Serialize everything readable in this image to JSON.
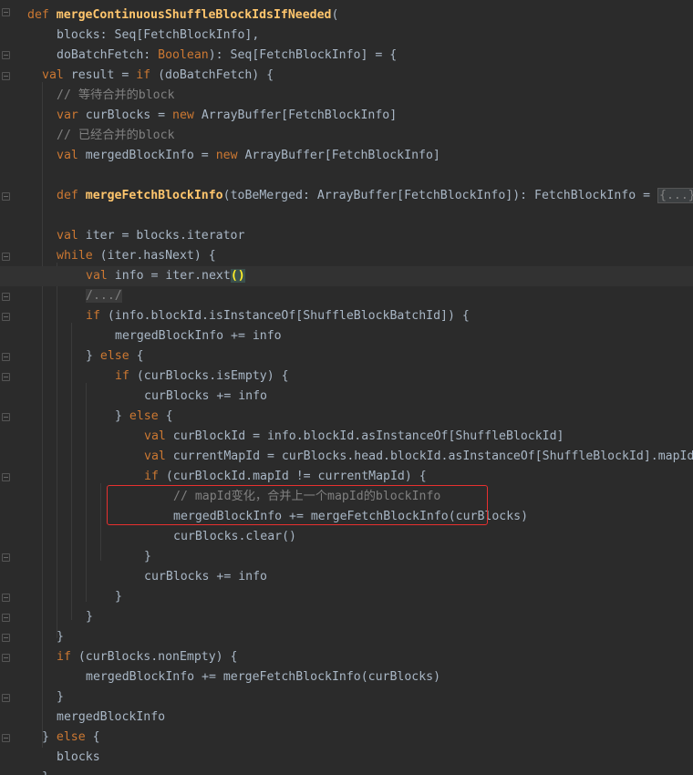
{
  "editor": {
    "language": "scala",
    "highlight_color": "#e8302f",
    "lines": [
      {
        "indent": 0,
        "tokens": [
          [
            "kw",
            "def "
          ],
          [
            "fn",
            "mergeContinuousShuffleBlockIdsIfNeeded"
          ],
          [
            "pu",
            "("
          ]
        ]
      },
      {
        "indent": 1,
        "tokens": [
          [
            "pu",
            "blocks: Seq[FetchBlockInfo],"
          ]
        ]
      },
      {
        "indent": 1,
        "tokens": [
          [
            "pu",
            "doBatchFetch: "
          ],
          [
            "kw",
            "Boolean"
          ],
          [
            "pu",
            "): Seq[FetchBlockInfo] = {"
          ]
        ]
      },
      {
        "indent": 0.5,
        "tokens": [
          [
            "kw",
            "val "
          ],
          [
            "pu",
            "result = "
          ],
          [
            "kw",
            "if "
          ],
          [
            "pu",
            "(doBatchFetch) {"
          ]
        ]
      },
      {
        "indent": 1,
        "tokens": [
          [
            "cm",
            "// 等待合并的block"
          ]
        ]
      },
      {
        "indent": 1,
        "tokens": [
          [
            "kw",
            "var "
          ],
          [
            "pu",
            "curBlocks = "
          ],
          [
            "kw",
            "new "
          ],
          [
            "pu",
            "ArrayBuffer[FetchBlockInfo]"
          ]
        ]
      },
      {
        "indent": 1,
        "tokens": [
          [
            "cm",
            "// 已经合并的block"
          ]
        ]
      },
      {
        "indent": 1,
        "tokens": [
          [
            "kw",
            "val "
          ],
          [
            "pu",
            "mergedBlockInfo = "
          ],
          [
            "kw",
            "new "
          ],
          [
            "pu",
            "ArrayBuffer[FetchBlockInfo]"
          ]
        ]
      },
      {
        "indent": 1,
        "tokens": []
      },
      {
        "indent": 1,
        "tokens": [
          [
            "kw",
            "def "
          ],
          [
            "fn",
            "mergeFetchBlockInfo"
          ],
          [
            "pu",
            "(toBeMerged: ArrayBuffer[FetchBlockInfo]): FetchBlockInfo = "
          ],
          [
            "fold",
            "{...}"
          ]
        ]
      },
      {
        "indent": 1,
        "tokens": []
      },
      {
        "indent": 1,
        "tokens": [
          [
            "kw",
            "val "
          ],
          [
            "pu",
            "iter = blocks.iterator"
          ]
        ]
      },
      {
        "indent": 1,
        "tokens": [
          [
            "kw",
            "while "
          ],
          [
            "pu",
            "(iter.hasNext) {"
          ]
        ]
      },
      {
        "indent": 2,
        "caret": true,
        "tokens": [
          [
            "kw",
            "val "
          ],
          [
            "pu",
            "info = iter.next"
          ],
          [
            "brace",
            "()"
          ]
        ]
      },
      {
        "indent": 2,
        "tokens": [
          [
            "coll",
            "/.../"
          ]
        ]
      },
      {
        "indent": 2,
        "tokens": [
          [
            "kw",
            "if "
          ],
          [
            "pu",
            "(info.blockId.isInstanceOf[ShuffleBlockBatchId]) {"
          ]
        ]
      },
      {
        "indent": 3,
        "tokens": [
          [
            "pu",
            "mergedBlockInfo += info"
          ]
        ]
      },
      {
        "indent": 2,
        "tokens": [
          [
            "pu",
            "} "
          ],
          [
            "kw",
            "else "
          ],
          [
            "pu",
            "{"
          ]
        ]
      },
      {
        "indent": 3,
        "tokens": [
          [
            "kw",
            "if "
          ],
          [
            "pu",
            "(curBlocks.isEmpty) {"
          ]
        ]
      },
      {
        "indent": 4,
        "tokens": [
          [
            "pu",
            "curBlocks += info"
          ]
        ]
      },
      {
        "indent": 3,
        "tokens": [
          [
            "pu",
            "} "
          ],
          [
            "kw",
            "else "
          ],
          [
            "pu",
            "{"
          ]
        ]
      },
      {
        "indent": 4,
        "tokens": [
          [
            "kw",
            "val "
          ],
          [
            "pu",
            "curBlockId = info.blockId.asInstanceOf[ShuffleBlockId]"
          ]
        ]
      },
      {
        "indent": 4,
        "tokens": [
          [
            "kw",
            "val "
          ],
          [
            "pu",
            "currentMapId = curBlocks.head.blockId.asInstanceOf[ShuffleBlockId].mapId"
          ]
        ]
      },
      {
        "indent": 4,
        "tokens": [
          [
            "kw",
            "if "
          ],
          [
            "pu",
            "(curBlockId.mapId != currentMapId) {"
          ]
        ]
      },
      {
        "indent": 5,
        "tokens": [
          [
            "cm",
            "// mapId变化，合并上一个mapId的blockInfo"
          ]
        ]
      },
      {
        "indent": 5,
        "tokens": [
          [
            "pu",
            "mergedBlockInfo += mergeFetchBlockInfo(curBlocks)"
          ]
        ]
      },
      {
        "indent": 5,
        "tokens": [
          [
            "pu",
            "curBlocks.clear()"
          ]
        ]
      },
      {
        "indent": 4,
        "tokens": [
          [
            "pu",
            "}"
          ]
        ]
      },
      {
        "indent": 4,
        "tokens": [
          [
            "pu",
            "curBlocks += info"
          ]
        ]
      },
      {
        "indent": 3,
        "tokens": [
          [
            "pu",
            "}"
          ]
        ]
      },
      {
        "indent": 2,
        "tokens": [
          [
            "pu",
            "}"
          ]
        ]
      },
      {
        "indent": 1,
        "tokens": [
          [
            "pu",
            "}"
          ]
        ]
      },
      {
        "indent": 1,
        "tokens": [
          [
            "kw",
            "if "
          ],
          [
            "pu",
            "(curBlocks.nonEmpty) {"
          ]
        ]
      },
      {
        "indent": 2,
        "tokens": [
          [
            "pu",
            "mergedBlockInfo += mergeFetchBlockInfo(curBlocks)"
          ]
        ]
      },
      {
        "indent": 1,
        "tokens": [
          [
            "pu",
            "}"
          ]
        ]
      },
      {
        "indent": 1,
        "tokens": [
          [
            "pu",
            "mergedBlockInfo"
          ]
        ]
      },
      {
        "indent": 0.5,
        "tokens": [
          [
            "pu",
            "} "
          ],
          [
            "kw",
            "else "
          ],
          [
            "pu",
            "{"
          ]
        ]
      },
      {
        "indent": 1,
        "tokens": [
          [
            "pu",
            "blocks"
          ]
        ]
      },
      {
        "indent": 0.5,
        "tokens": [
          [
            "pu",
            "}"
          ]
        ]
      }
    ]
  }
}
